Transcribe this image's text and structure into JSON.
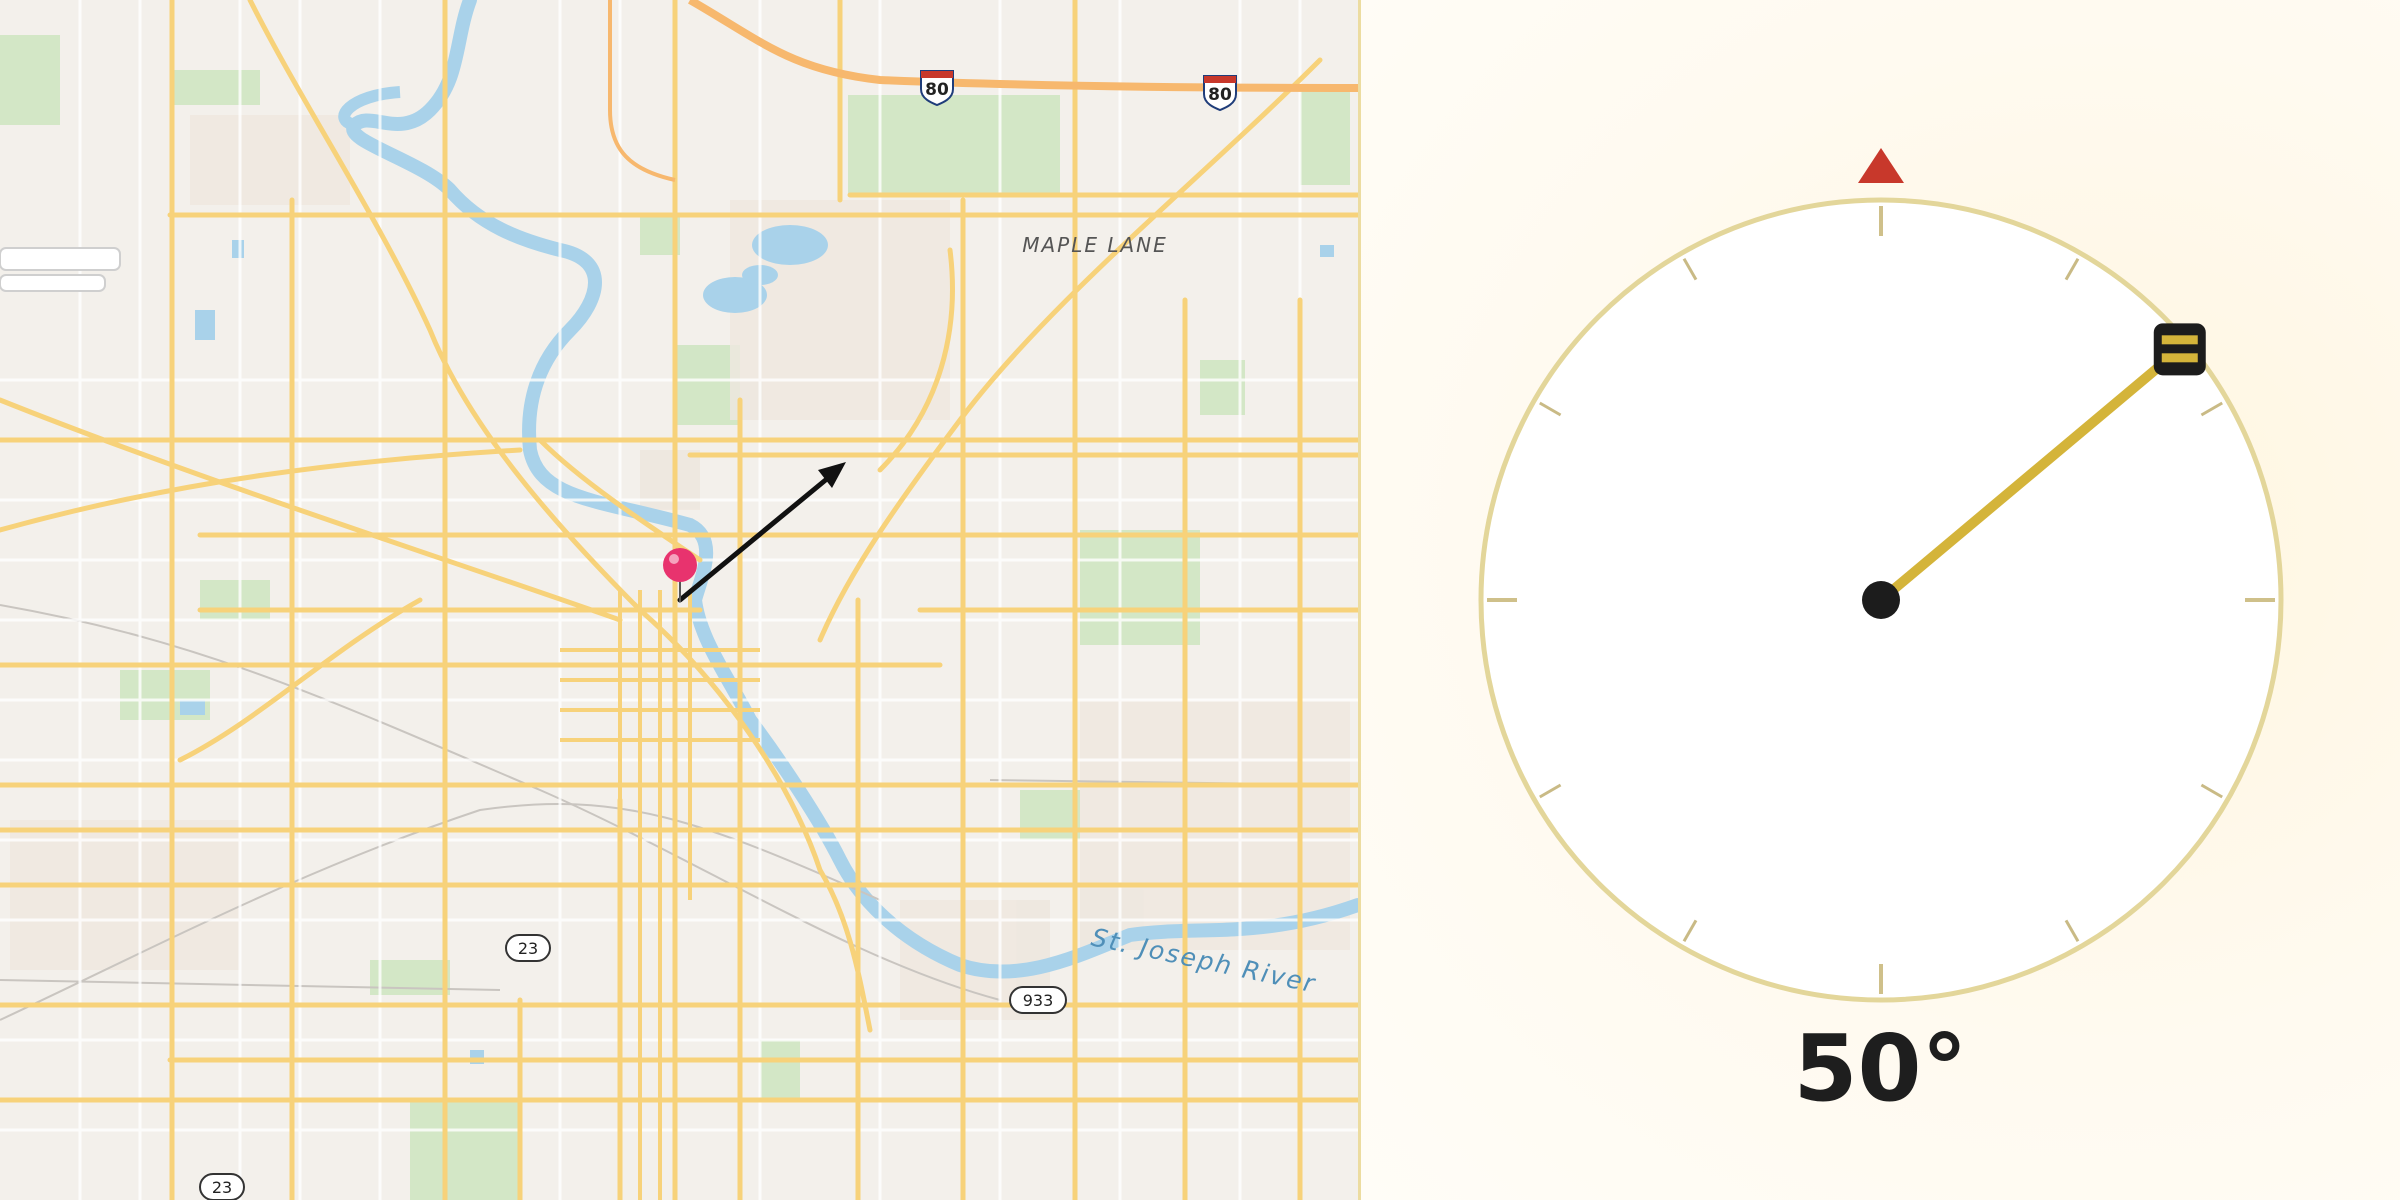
{
  "map": {
    "place_label": "MAPLE LANE",
    "river_label": "St. Joseph River",
    "highway_shields": [
      {
        "route": "80",
        "kind": "interstate"
      },
      {
        "route": "80",
        "kind": "interstate"
      },
      {
        "route": "23",
        "kind": "us"
      },
      {
        "route": "23",
        "kind": "us"
      },
      {
        "route": "933",
        "kind": "us"
      }
    ],
    "pin_color": "#e8336e",
    "arrow_color": "#111111"
  },
  "compass": {
    "heading_deg": 50,
    "heading_label": "50°",
    "needle_color": "#d4b43a",
    "north_marker_color": "#c8382b",
    "ring_color": "#e3d69a"
  }
}
